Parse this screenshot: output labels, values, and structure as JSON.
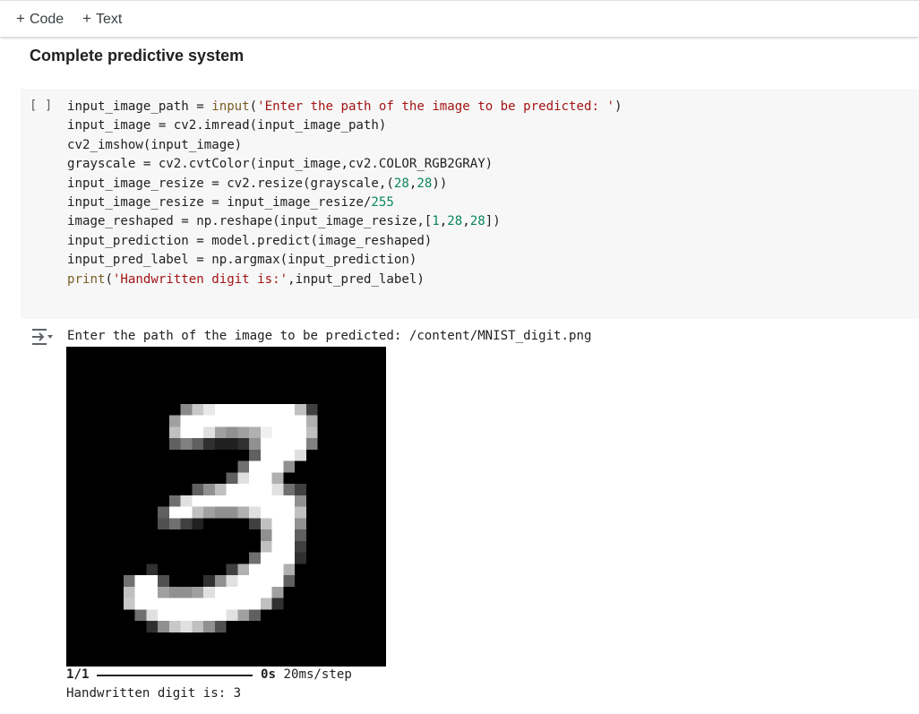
{
  "toolbar": {
    "code_button": "Code",
    "text_button": "Text"
  },
  "cell": {
    "heading": "Complete predictive system",
    "run_indicator": "[ ]",
    "code_lines": [
      [
        {
          "t": "input_image_path = "
        },
        {
          "t": "input",
          "c": "fn"
        },
        {
          "t": "("
        },
        {
          "t": "'Enter the path of the image to be predicted: '",
          "c": "str"
        },
        {
          "t": ")"
        }
      ],
      [
        {
          "t": "input_image = cv2.imread(input_image_path)"
        }
      ],
      [
        {
          "t": "cv2_imshow(input_image)"
        }
      ],
      [
        {
          "t": "grayscale = cv2.cvtColor(input_image,cv2.COLOR_RGB2GRAY)"
        }
      ],
      [
        {
          "t": "input_image_resize = cv2.resize(grayscale,("
        },
        {
          "t": "28",
          "c": "num"
        },
        {
          "t": ","
        },
        {
          "t": "28",
          "c": "num"
        },
        {
          "t": "))"
        }
      ],
      [
        {
          "t": "input_image_resize = input_image_resize/"
        },
        {
          "t": "255",
          "c": "num"
        }
      ],
      [
        {
          "t": "image_reshaped = np.reshape(input_image_resize,["
        },
        {
          "t": "1",
          "c": "num"
        },
        {
          "t": ","
        },
        {
          "t": "28",
          "c": "num"
        },
        {
          "t": ","
        },
        {
          "t": "28",
          "c": "num"
        },
        {
          "t": "])"
        }
      ],
      [
        {
          "t": "input_prediction = model.predict(image_reshaped)"
        }
      ],
      [
        {
          "t": "input_pred_label = np.argmax(input_prediction)"
        }
      ],
      [
        {
          "t": "print",
          "c": "fn"
        },
        {
          "t": "("
        },
        {
          "t": "'Handwritten digit is:'",
          "c": "str"
        },
        {
          "t": ",input_pred_label)"
        }
      ]
    ]
  },
  "output": {
    "prompt_line": "Enter the path of the image to be predicted: /content/MNIST_digit.png",
    "progress_step": "1/1",
    "progress_percent": 100,
    "progress_time": "0s",
    "progress_rate": "20ms/step",
    "result_line": "Handwritten digit is: 3"
  },
  "image": {
    "description_icon": "mnist-digit-3-image",
    "background": "#000000",
    "foreground": "#ffffff"
  },
  "colors": {
    "function": "#795e26",
    "string": "#a31515",
    "number": "#098658",
    "cell_bg": "#f7f7f7"
  }
}
